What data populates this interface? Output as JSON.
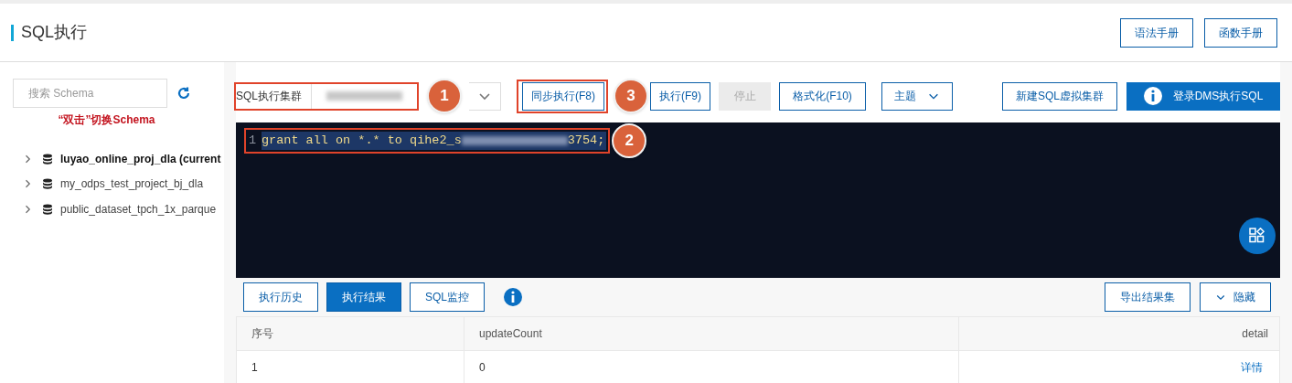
{
  "page": {
    "title": "SQL执行",
    "header_buttons": [
      "语法手册",
      "函数手册"
    ]
  },
  "sidebar": {
    "search": {
      "placeholder": "搜索 Schema"
    },
    "hint": "“双击”切换Schema",
    "items": [
      {
        "label": "luyao_online_proj_dla (current",
        "current": true
      },
      {
        "label": "my_odps_test_project_bj_dla",
        "current": false
      },
      {
        "label": "public_dataset_tpch_1x_parque",
        "current": false
      }
    ]
  },
  "toolbar": {
    "cluster_label": "SQL执行集群",
    "buttons": [
      {
        "label": "同步执行(F8)",
        "kind": "outline",
        "disabled": false
      },
      {
        "label": "执行(F9)",
        "kind": "outline",
        "disabled": false
      },
      {
        "label": "停止",
        "kind": "outline",
        "disabled": true
      },
      {
        "label": "格式化(F10)",
        "kind": "outline",
        "disabled": false
      },
      {
        "label": "主题",
        "kind": "dropdown",
        "disabled": false
      }
    ],
    "right_buttons": [
      {
        "label": "新建SQL虚拟集群",
        "kind": "outline"
      },
      {
        "label": "登录DMS执行SQL",
        "kind": "primary"
      }
    ]
  },
  "editor": {
    "lines": [
      {
        "number": "1",
        "code_start": "grant all on *.* to qihe2_s",
        "code_end": "3754;"
      }
    ]
  },
  "annotations": [
    "1",
    "2",
    "3"
  ],
  "result_tabs": [
    {
      "label": "执行历史",
      "selected": false
    },
    {
      "label": "执行结果",
      "selected": true
    },
    {
      "label": "SQL监控",
      "selected": false
    }
  ],
  "result_actions": [
    {
      "label": "导出结果集",
      "kind": "plain"
    },
    {
      "label": "隐藏",
      "kind": "collapse"
    }
  ],
  "table": {
    "columns": [
      "序号",
      "updateCount",
      "detail"
    ],
    "rows": [
      [
        "1",
        "0",
        "详情"
      ]
    ]
  }
}
